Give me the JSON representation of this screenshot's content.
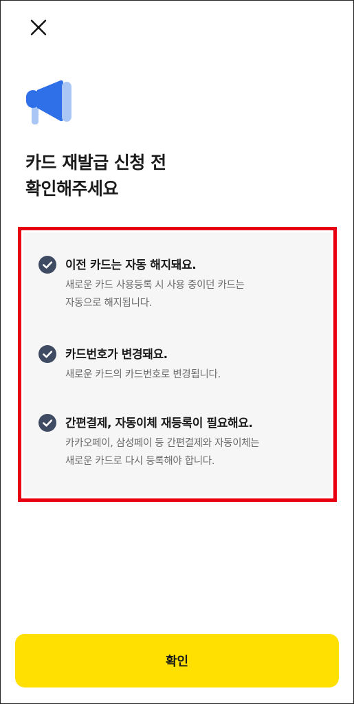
{
  "header": {
    "close_icon": "close-icon",
    "illustration_icon": "megaphone-icon"
  },
  "title": {
    "line1": "카드 재발급 신청 전",
    "line2": "확인해주세요"
  },
  "notices": [
    {
      "title": "이전 카드는 자동 해지돼요.",
      "desc_lines": [
        "새로운 카드 사용등록 시 사용 중이던 카드는",
        "자동으로 해지됩니다."
      ]
    },
    {
      "title": "카드번호가 변경돼요.",
      "desc_lines": [
        "새로운 카드의 카드번호로 변경됩니다."
      ]
    },
    {
      "title": "간편결제, 자동이체 재등록이 필요해요.",
      "desc_lines": [
        "카카오페이, 삼성페이 등 간편결제와 자동이체는",
        "새로운 카드로 다시 등록해야 합니다."
      ]
    }
  ],
  "footer": {
    "confirm_label": "확인"
  },
  "colors": {
    "accent_yellow": "#ffe000",
    "check_navy": "#3f4a63",
    "highlight_red": "#e60012",
    "megaphone_blue": "#2f6fe8",
    "megaphone_light": "#a9c6f5"
  }
}
